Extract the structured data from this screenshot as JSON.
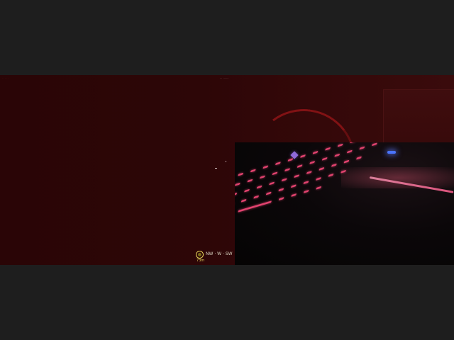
{
  "game_view": {
    "top_left_text": "· · · · ·",
    "top_center_text": "··· ·······",
    "hud": {
      "compass": "NW · W · SW",
      "distance": "73m",
      "marker_icon": "waypoint-ring-icon"
    }
  },
  "webcam_overlay": {
    "scene": "RGB keyboard in dark room",
    "colors": {
      "keys": "#e0426e",
      "strip": "#ff5f8f",
      "accent_blue": "#4a74ff"
    }
  },
  "colors": {
    "background": "#2d0607",
    "letterbox": "#1e1e1e",
    "hud_yellow": "#e4d25a"
  }
}
